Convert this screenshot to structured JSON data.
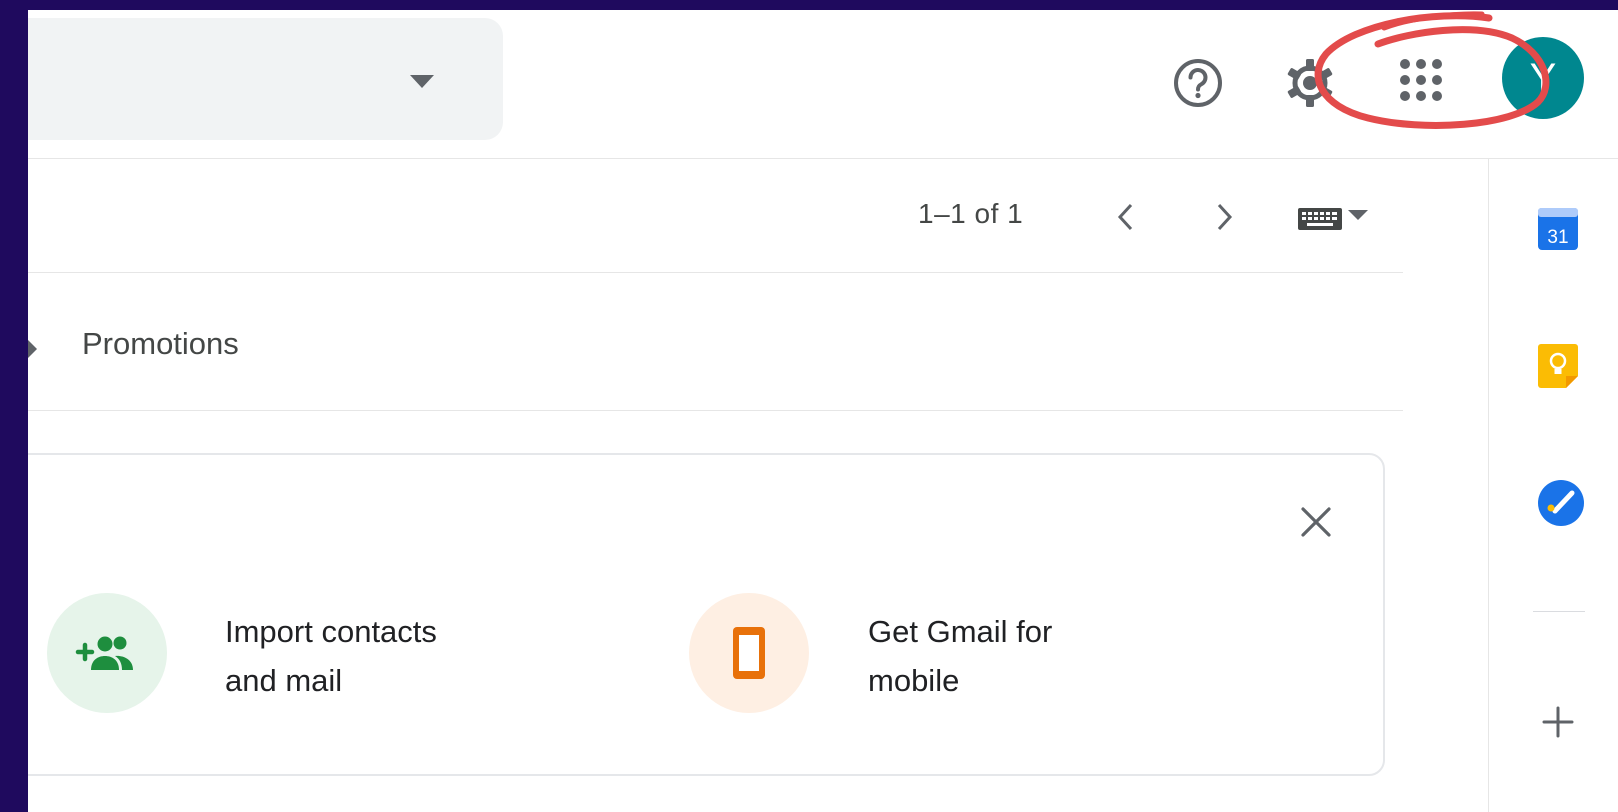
{
  "header": {
    "avatar_initial": "Y",
    "icons": [
      "help-icon",
      "settings-icon",
      "apps-grid-icon"
    ],
    "annotation_color": "#e34b4b"
  },
  "toolbar": {
    "page_count": "1–1 of 1",
    "icons": [
      "chevron-left-icon",
      "chevron-right-icon",
      "keyboard-icon"
    ]
  },
  "tabs": [
    {
      "label": "Promotions"
    }
  ],
  "setup_card": {
    "items": [
      {
        "line1": "Import contacts",
        "line2": "and mail",
        "icon": "add-people-icon",
        "color": "#1e8e3e"
      },
      {
        "line1": "Get Gmail for",
        "line2": "mobile",
        "icon": "phone-icon",
        "color": "#e8710a"
      }
    ]
  },
  "side_panel": {
    "calendar_day": "31",
    "icons": [
      "calendar-icon",
      "keep-icon",
      "tasks-icon",
      "add-icon"
    ]
  },
  "colors": {
    "background": "#1f0a5e",
    "avatar": "#00878f",
    "text_secondary": "#444746"
  }
}
